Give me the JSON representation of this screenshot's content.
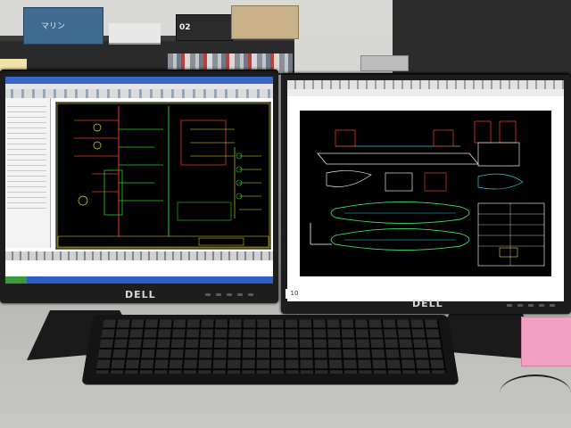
{
  "scene": {
    "left_monitor": {
      "brand": "DELL"
    },
    "right_monitor": {
      "brand": "DELL",
      "tag_label": "10"
    },
    "shelf": {
      "blue_box_label": "マリン",
      "black_box_label": "02"
    }
  },
  "colors": {
    "cad_background": "#000000",
    "taskbar_blue": "#2f5fc4",
    "wiring_green": "#1cd41c",
    "wiring_red": "#e03a2a",
    "wiring_yellow": "#e6dd2a",
    "ship_cyan": "#2ad1e0",
    "ship_green": "#3fe36a",
    "pink_box": "#f3a1c2"
  },
  "icons": [
    "start-button-icon",
    "toolbar-icons",
    "compass-axis-icon"
  ]
}
